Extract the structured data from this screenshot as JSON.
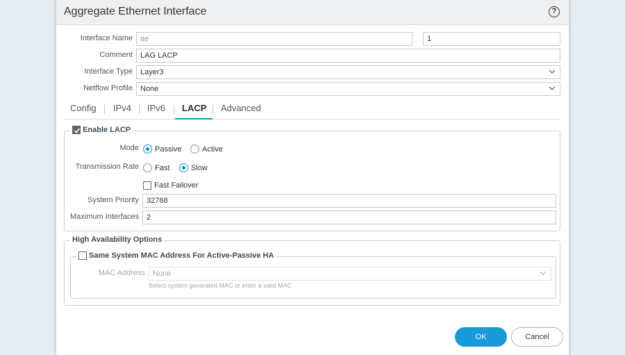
{
  "dialog": {
    "title": "Aggregate Ethernet Interface",
    "help_icon": "question-icon"
  },
  "form": {
    "interface_name": {
      "label": "Interface Name",
      "placeholder": "ae",
      "suffix": "1"
    },
    "comment": {
      "label": "Comment",
      "value": "LAG LACP"
    },
    "interface_type": {
      "label": "Interface Type",
      "value": "Layer3"
    },
    "netflow_profile": {
      "label": "Netflow Profile",
      "value": "None"
    }
  },
  "tabs": [
    {
      "label": "Config",
      "active": false
    },
    {
      "label": "IPv4",
      "active": false
    },
    {
      "label": "IPv6",
      "active": false
    },
    {
      "label": "LACP",
      "active": true
    },
    {
      "label": "Advanced",
      "active": false
    }
  ],
  "lacp": {
    "enable_label": "Enable LACP",
    "enabled": true,
    "mode": {
      "label": "Mode",
      "options": [
        "Passive",
        "Active"
      ],
      "selected": "Passive"
    },
    "transmission_rate": {
      "label": "Transmission Rate",
      "options": [
        "Fast",
        "Slow"
      ],
      "selected": "Slow"
    },
    "fast_failover": {
      "label": "Fast Failover",
      "checked": false
    },
    "system_priority": {
      "label": "System Priority",
      "value": "32768"
    },
    "maximum_interfaces": {
      "label": "Maximum Interfaces",
      "value": "2"
    }
  },
  "ha": {
    "legend": "High Availability Options",
    "same_mac_label": "Same System MAC Address For Active-Passive HA",
    "same_mac_checked": false,
    "mac_address": {
      "label": "MAC Address",
      "value": "None",
      "hint": "Select system generated MAC or enter a valid MAC"
    }
  },
  "buttons": {
    "ok": "OK",
    "cancel": "Cancel"
  },
  "colors": {
    "accent": "#1a9ad9",
    "tab_underline": "#1a8bd6"
  }
}
